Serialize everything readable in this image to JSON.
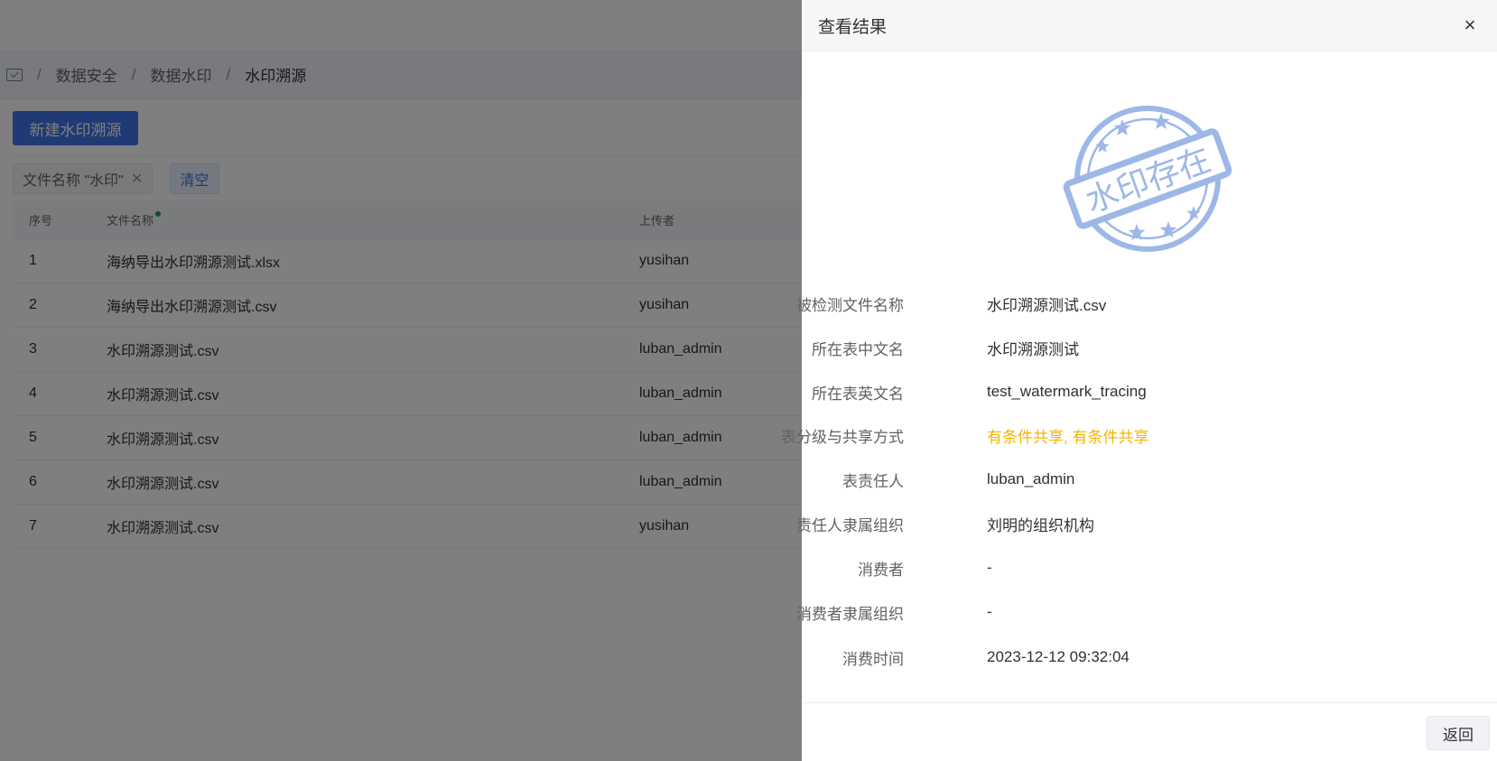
{
  "breadcrumb": {
    "items": [
      "数据安全",
      "数据水印",
      "水印溯源"
    ],
    "separator": "/"
  },
  "toolbar": {
    "new_button_label": "新建水印溯源"
  },
  "filter": {
    "tag_label": "文件名称 \"水印\"",
    "clear_label": "清空"
  },
  "table": {
    "headers": [
      "序号",
      "文件名称",
      "上传者"
    ],
    "rows": [
      {
        "index": "1",
        "file_name": "海纳导出水印溯源测试.xlsx",
        "uploader": "yusihan"
      },
      {
        "index": "2",
        "file_name": "海纳导出水印溯源测试.csv",
        "uploader": "yusihan"
      },
      {
        "index": "3",
        "file_name": "水印溯源测试.csv",
        "uploader": "luban_admin"
      },
      {
        "index": "4",
        "file_name": "水印溯源测试.csv",
        "uploader": "luban_admin"
      },
      {
        "index": "5",
        "file_name": "水印溯源测试.csv",
        "uploader": "luban_admin"
      },
      {
        "index": "6",
        "file_name": "水印溯源测试.csv",
        "uploader": "luban_admin"
      },
      {
        "index": "7",
        "file_name": "水印溯源测试.csv",
        "uploader": "yusihan"
      }
    ]
  },
  "drawer": {
    "title": "查看结果",
    "close_symbol": "×",
    "stamp_text": "水印存在",
    "stamp_color": "#9db8e6",
    "details": [
      {
        "label": "被检测文件名称",
        "value": "水印溯源测试.csv"
      },
      {
        "label": "所在表中文名",
        "value": "水印溯源测试"
      },
      {
        "label": "所在表英文名",
        "value": "test_watermark_tracing"
      },
      {
        "label": "表分级与共享方式",
        "value": "有条件共享, 有条件共享"
      },
      {
        "label": "表责任人",
        "value": "luban_admin"
      },
      {
        "label": "责任人隶属组织",
        "value": "刘明的组织机构"
      },
      {
        "label": "消费者",
        "value": "-"
      },
      {
        "label": "消费者隶属组织",
        "value": "-"
      },
      {
        "label": "消费时间",
        "value": "2023-12-12 09:32:04"
      }
    ],
    "back_label": "返回"
  },
  "colors": {
    "primary": "#3f74e8",
    "warning_text": "#f5b400"
  }
}
